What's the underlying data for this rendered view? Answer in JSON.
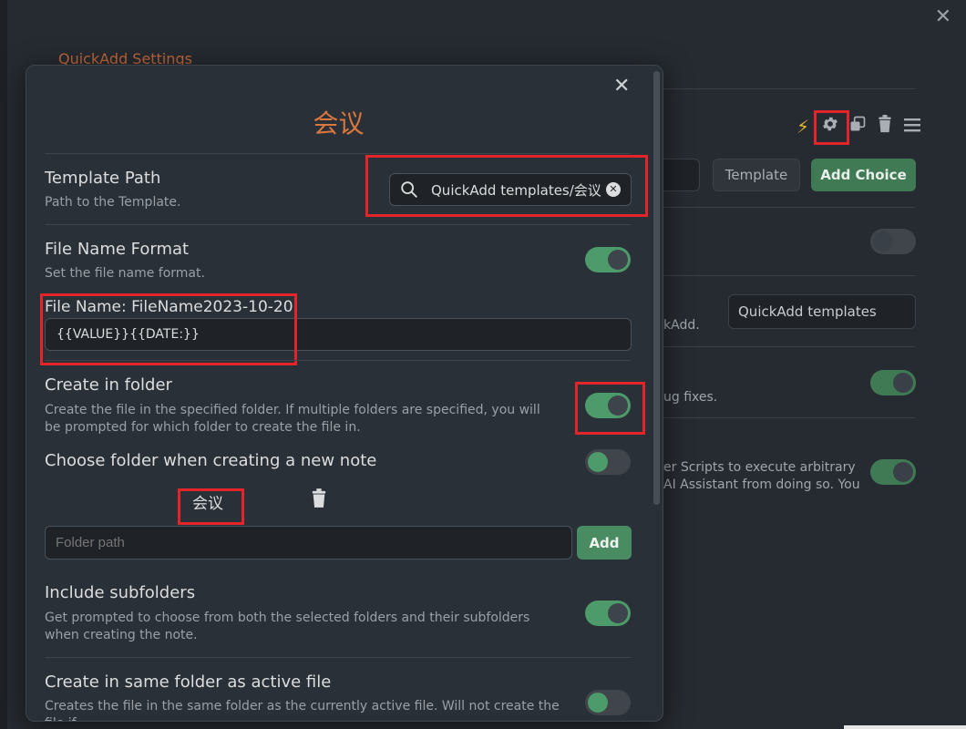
{
  "background": {
    "title": "QuickAdd Settings",
    "template_button": "Template",
    "add_choice_button": "Add Choice",
    "template_folder_suffix": "kAdd.",
    "template_folder_value": "QuickAdd templates",
    "announce_suffix": "ug fixes.",
    "scripts_text_line1": "er Scripts to execute arbitrary",
    "scripts_text_line2": "AI Assistant from doing so. You"
  },
  "modal": {
    "title": "会议",
    "template_path": {
      "name": "Template Path",
      "desc": "Path to the Template.",
      "value": "QuickAdd templates/会议"
    },
    "file_name_format": {
      "name": "File Name Format",
      "desc": "Set the file name format.",
      "preview_label": "File Name: FileName2023-10-20",
      "value": "{{VALUE}}{{DATE:}}",
      "enabled": true
    },
    "create_in_folder": {
      "name": "Create in folder",
      "desc": "Create the file in the specified folder. If multiple folders are specified, you will be prompted for which folder to create the file in.",
      "enabled": true
    },
    "choose_folder": {
      "name": "Choose folder when creating a new note",
      "enabled": false
    },
    "folders": [
      "会议"
    ],
    "folder_input": {
      "placeholder": "Folder path",
      "add_label": "Add"
    },
    "include_subfolders": {
      "name": "Include subfolders",
      "desc": "Get prompted to choose from both the selected folders and their subfolders when creating the note.",
      "enabled": true
    },
    "same_folder": {
      "name": "Create in same folder as active file",
      "desc": "Creates the file in the same folder as the currently active file. Will not create the file if",
      "enabled": false
    }
  },
  "colors": {
    "accent_orange": "#d9773f",
    "toggle_on": "#4d9a6a",
    "highlight_red": "#e3242b"
  }
}
